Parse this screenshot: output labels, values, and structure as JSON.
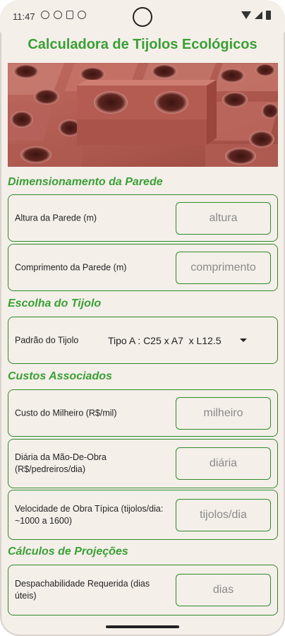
{
  "status_bar": {
    "time": "11:47"
  },
  "app": {
    "title": "Calculadora de Tijolos Ecológicos"
  },
  "sections": {
    "wall": "Dimensionamento da Parede",
    "brick": "Escolha do Tijolo",
    "costs": "Custos Associados",
    "projections": "Cálculos de Projeções"
  },
  "fields": {
    "wall_height": {
      "label": "Altura da Parede (m)",
      "placeholder": "altura",
      "value": ""
    },
    "wall_length": {
      "label": "Comprimento da Parede (m)",
      "placeholder": "comprimento",
      "value": ""
    },
    "brick_pattern": {
      "label": "Padrão do Tijolo",
      "selected": "Tipo A : C25 x A7  x L12.5"
    },
    "cost_thousand": {
      "label": "Custo do Milheiro (R$/mil)",
      "placeholder": "milheiro",
      "value": ""
    },
    "labor_daily": {
      "label": "Diária da Mão-De-Obra (R$/pedreiros/dia)",
      "placeholder": "diária",
      "value": ""
    },
    "work_speed": {
      "label": "Velocidade de Obra Típica (tijolos/dia: ~1000 a 1600)",
      "placeholder": "tijolos/dia",
      "value": ""
    },
    "dispatch": {
      "label": "Despachabilidade Requerida (dias úteis)",
      "placeholder": "dias",
      "value": ""
    }
  },
  "colors": {
    "accent": "#3aa035",
    "border": "#2f8a2a",
    "background": "#f5efea",
    "brick": "#b5584c"
  },
  "icons": {
    "dropdown": "chevron-down-icon",
    "hero": "eco-brick-image"
  }
}
